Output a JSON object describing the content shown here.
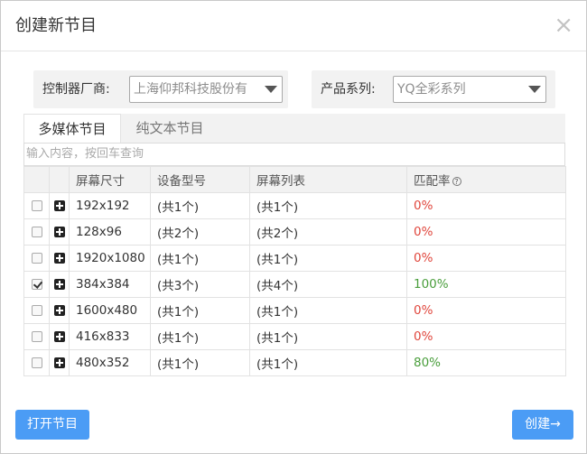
{
  "dialog": {
    "title": "创建新节目",
    "close_glyph": "×"
  },
  "filters": {
    "vendor_label": "控制器厂商:",
    "vendor_value": "上海仰邦科技股份有",
    "series_label": "产品系列:",
    "series_value": "YQ全彩系列"
  },
  "tabs": [
    {
      "label": "多媒体节目",
      "active": true
    },
    {
      "label": "纯文本节目",
      "active": false
    }
  ],
  "search": {
    "placeholder": "输入内容，按回车查询",
    "value": ""
  },
  "table": {
    "columns": [
      "屏幕尺寸",
      "设备型号",
      "屏幕列表",
      "匹配率"
    ],
    "help_glyph": "?",
    "rows": [
      {
        "checked": false,
        "size": "192x192",
        "device": "(共1个)",
        "screens": "(共1个)",
        "rate": "0%",
        "rate_color": "#e0463c"
      },
      {
        "checked": false,
        "size": "128x96",
        "device": "(共2个)",
        "screens": "(共2个)",
        "rate": "0%",
        "rate_color": "#e0463c"
      },
      {
        "checked": false,
        "size": "1920x1080",
        "device": "(共1个)",
        "screens": "(共1个)",
        "rate": "0%",
        "rate_color": "#e0463c"
      },
      {
        "checked": true,
        "size": "384x384",
        "device": "(共3个)",
        "screens": "(共4个)",
        "rate": "100%",
        "rate_color": "#4a9e3c"
      },
      {
        "checked": false,
        "size": "1600x480",
        "device": "(共1个)",
        "screens": "(共1个)",
        "rate": "0%",
        "rate_color": "#e0463c"
      },
      {
        "checked": false,
        "size": "416x833",
        "device": "(共1个)",
        "screens": "(共1个)",
        "rate": "0%",
        "rate_color": "#e0463c"
      },
      {
        "checked": false,
        "size": "480x352",
        "device": "(共1个)",
        "screens": "(共1个)",
        "rate": "80%",
        "rate_color": "#4a9e3c"
      }
    ]
  },
  "buttons": {
    "open_label": "打开节目",
    "create_label": "创建→"
  }
}
